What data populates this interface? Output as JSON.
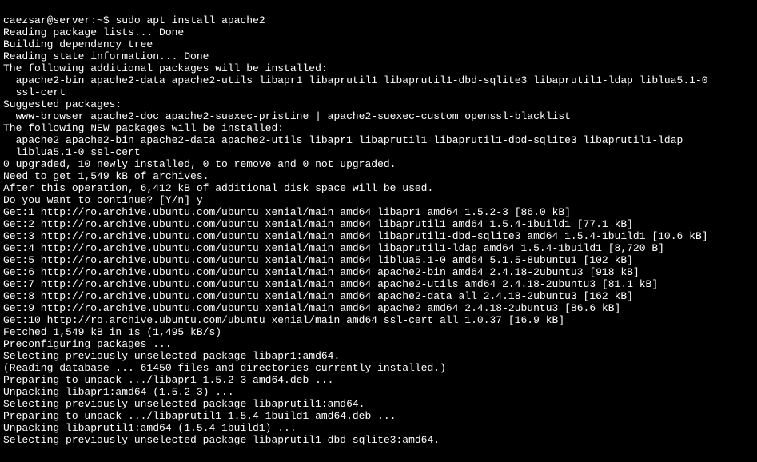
{
  "prompt": {
    "user_host": "caezsar@server",
    "path": "~",
    "symbol": "$",
    "command": "sudo apt install apache2"
  },
  "lines": [
    "Reading package lists... Done",
    "Building dependency tree",
    "Reading state information... Done",
    "The following additional packages will be installed:",
    "  apache2-bin apache2-data apache2-utils libapr1 libaprutil1 libaprutil1-dbd-sqlite3 libaprutil1-ldap liblua5.1-0",
    "  ssl-cert",
    "Suggested packages:",
    "  www-browser apache2-doc apache2-suexec-pristine | apache2-suexec-custom openssl-blacklist",
    "The following NEW packages will be installed:",
    "  apache2 apache2-bin apache2-data apache2-utils libapr1 libaprutil1 libaprutil1-dbd-sqlite3 libaprutil1-ldap",
    "  liblua5.1-0 ssl-cert",
    "0 upgraded, 10 newly installed, 0 to remove and 0 not upgraded.",
    "Need to get 1,549 kB of archives.",
    "After this operation, 6,412 kB of additional disk space will be used.",
    "Do you want to continue? [Y/n] y",
    "Get:1 http://ro.archive.ubuntu.com/ubuntu xenial/main amd64 libapr1 amd64 1.5.2-3 [86.0 kB]",
    "Get:2 http://ro.archive.ubuntu.com/ubuntu xenial/main amd64 libaprutil1 amd64 1.5.4-1build1 [77.1 kB]",
    "Get:3 http://ro.archive.ubuntu.com/ubuntu xenial/main amd64 libaprutil1-dbd-sqlite3 amd64 1.5.4-1build1 [10.6 kB]",
    "Get:4 http://ro.archive.ubuntu.com/ubuntu xenial/main amd64 libaprutil1-ldap amd64 1.5.4-1build1 [8,720 B]",
    "Get:5 http://ro.archive.ubuntu.com/ubuntu xenial/main amd64 liblua5.1-0 amd64 5.1.5-8ubuntu1 [102 kB]",
    "Get:6 http://ro.archive.ubuntu.com/ubuntu xenial/main amd64 apache2-bin amd64 2.4.18-2ubuntu3 [918 kB]",
    "Get:7 http://ro.archive.ubuntu.com/ubuntu xenial/main amd64 apache2-utils amd64 2.4.18-2ubuntu3 [81.1 kB]",
    "Get:8 http://ro.archive.ubuntu.com/ubuntu xenial/main amd64 apache2-data all 2.4.18-2ubuntu3 [162 kB]",
    "Get:9 http://ro.archive.ubuntu.com/ubuntu xenial/main amd64 apache2 amd64 2.4.18-2ubuntu3 [86.6 kB]",
    "Get:10 http://ro.archive.ubuntu.com/ubuntu xenial/main amd64 ssl-cert all 1.0.37 [16.9 kB]",
    "Fetched 1,549 kB in 1s (1,495 kB/s)",
    "Preconfiguring packages ...",
    "Selecting previously unselected package libapr1:amd64.",
    "(Reading database ... 61450 files and directories currently installed.)",
    "Preparing to unpack .../libapr1_1.5.2-3_amd64.deb ...",
    "Unpacking libapr1:amd64 (1.5.2-3) ...",
    "Selecting previously unselected package libaprutil1:amd64.",
    "Preparing to unpack .../libaprutil1_1.5.4-1build1_amd64.deb ...",
    "Unpacking libaprutil1:amd64 (1.5.4-1build1) ...",
    "Selecting previously unselected package libaprutil1-dbd-sqlite3:amd64."
  ]
}
